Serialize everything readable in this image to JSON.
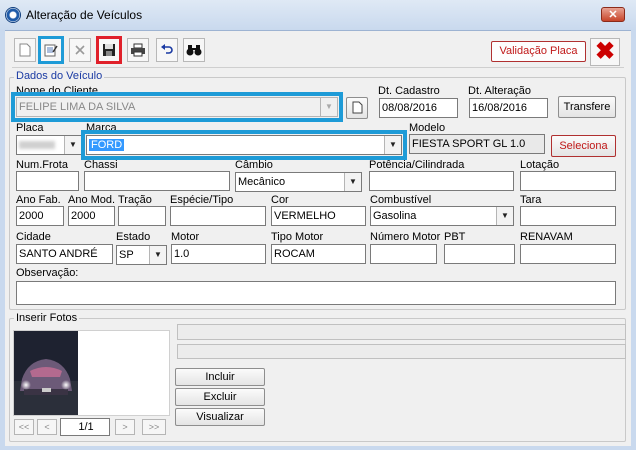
{
  "window": {
    "title": "Alteração de Veículos",
    "close_glyph": "✕"
  },
  "toolbar": {
    "new_icon": "new-document-icon",
    "edit_icon": "edit-document-icon",
    "delete_icon": "delete-x-icon",
    "save_icon": "save-floppy-icon",
    "print_icon": "printer-icon",
    "undo_icon": "undo-arrow-icon",
    "search_icon": "binoculars-icon",
    "validate_label": "Validação Placa",
    "exit_glyph": "✖"
  },
  "vehicle": {
    "legend": "Dados do Veículo",
    "client_label": "Nome do Cliente",
    "client_value": "FELIPE LIMA DA SILVA",
    "cadastro_label": "Dt. Cadastro",
    "cadastro_value": "08/08/2016",
    "alteracao_label": "Dt. Alteração",
    "alteracao_value": "16/08/2016",
    "transfer_label": "Transfere",
    "placa_label": "Placa",
    "marca_label": "Marca",
    "marca_value": "FORD",
    "modelo_label": "Modelo",
    "modelo_value": "FIESTA SPORT GL 1.0",
    "seleciona_label": "Seleciona",
    "frota_label": "Num.Frota",
    "frota_value": "",
    "chassi_label": "Chassi",
    "chassi_value": "",
    "cambio_label": "Câmbio",
    "cambio_value": "Mecânico",
    "potencia_label": "Potência/Cilindrada",
    "potencia_value": "",
    "lotacao_label": "Lotação",
    "lotacao_value": "",
    "anofab_label": "Ano Fab.",
    "anofab_value": "2000",
    "anomod_label": "Ano Mod.",
    "anomod_value": "2000",
    "tracao_label": "Tração",
    "tracao_value": "",
    "especie_label": "Espécie/Tipo",
    "especie_value": "",
    "cor_label": "Cor",
    "cor_value": "VERMELHO",
    "combustivel_label": "Combustível",
    "combustivel_value": "Gasolina",
    "tara_label": "Tara",
    "tara_value": "",
    "cidade_label": "Cidade",
    "cidade_value": "SANTO ANDRÉ",
    "estado_label": "Estado",
    "estado_value": "SP",
    "motor_label": "Motor",
    "motor_value": "1.0",
    "tipomotor_label": "Tipo Motor",
    "tipomotor_value": "ROCAM",
    "nummotor_label": "Número Motor",
    "nummotor_value": "",
    "pbt_label": "PBT",
    "pbt_value": "",
    "renavam_label": "RENAVAM",
    "renavam_value": "",
    "obs_label": "Observação:",
    "obs_value": ""
  },
  "photos": {
    "legend": "Inserir Fotos",
    "include_label": "Incluir",
    "delete_label": "Excluir",
    "view_label": "Visualizar",
    "page_value": "1/1",
    "first_glyph": "<<",
    "prev_glyph": "<",
    "next_glyph": ">",
    "last_glyph": ">>"
  },
  "colors": {
    "highlight_blue": "#1e9bd7",
    "highlight_red": "#e0202a",
    "accent_red_text": "#c01818"
  }
}
